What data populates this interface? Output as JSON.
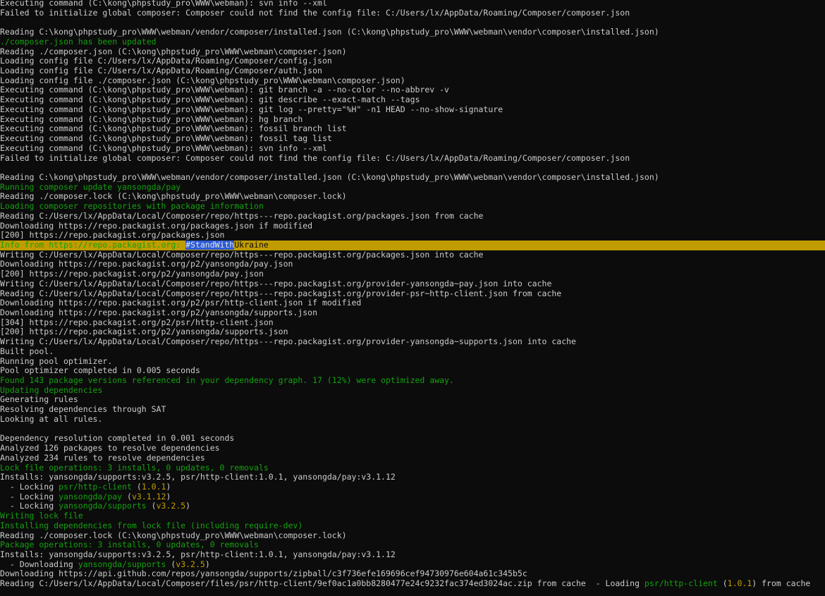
{
  "terminal": {
    "colors": {
      "background": "#0c0c0c",
      "default": "#cccccc",
      "green": "#13a10e",
      "yellow": "#c19c00",
      "selection": "#2c5bd6"
    },
    "lines": [
      {
        "segments": [
          {
            "t": "Executing command (C:\\kong\\phpstudy_pro\\WWW\\webman): svn info --xml",
            "c": "default"
          }
        ]
      },
      {
        "segments": [
          {
            "t": "Failed to initialize global composer: Composer could not find the config file: C:/Users/lx/AppData/Roaming/Composer/composer.json",
            "c": "default"
          }
        ]
      },
      {
        "segments": [
          {
            "t": "",
            "c": "default"
          }
        ]
      },
      {
        "segments": [
          {
            "t": "Reading C:\\kong\\phpstudy_pro\\WWW\\webman/vendor/composer/installed.json (C:\\kong\\phpstudy_pro\\WWW\\webman\\vendor\\composer\\installed.json)",
            "c": "default"
          }
        ]
      },
      {
        "segments": [
          {
            "t": "./composer.json has been updated",
            "c": "green"
          }
        ]
      },
      {
        "segments": [
          {
            "t": "Reading ./composer.json (C:\\kong\\phpstudy_pro\\WWW\\webman\\composer.json)",
            "c": "default"
          }
        ]
      },
      {
        "segments": [
          {
            "t": "Loading config file C:/Users/lx/AppData/Roaming/Composer/config.json",
            "c": "default"
          }
        ]
      },
      {
        "segments": [
          {
            "t": "Loading config file C:/Users/lx/AppData/Roaming/Composer/auth.json",
            "c": "default"
          }
        ]
      },
      {
        "segments": [
          {
            "t": "Loading config file ./composer.json (C:\\kong\\phpstudy_pro\\WWW\\webman\\composer.json)",
            "c": "default"
          }
        ]
      },
      {
        "segments": [
          {
            "t": "Executing command (C:\\kong\\phpstudy_pro\\WWW\\webman): git branch -a --no-color --no-abbrev -v",
            "c": "default"
          }
        ]
      },
      {
        "segments": [
          {
            "t": "Executing command (C:\\kong\\phpstudy_pro\\WWW\\webman): git describe --exact-match --tags",
            "c": "default"
          }
        ]
      },
      {
        "segments": [
          {
            "t": "Executing command (C:\\kong\\phpstudy_pro\\WWW\\webman): git log --pretty=\"%H\" -n1 HEAD --no-show-signature",
            "c": "default"
          }
        ]
      },
      {
        "segments": [
          {
            "t": "Executing command (C:\\kong\\phpstudy_pro\\WWW\\webman): hg branch",
            "c": "default"
          }
        ]
      },
      {
        "segments": [
          {
            "t": "Executing command (C:\\kong\\phpstudy_pro\\WWW\\webman): fossil branch list",
            "c": "default"
          }
        ]
      },
      {
        "segments": [
          {
            "t": "Executing command (C:\\kong\\phpstudy_pro\\WWW\\webman): fossil tag list",
            "c": "default"
          }
        ]
      },
      {
        "segments": [
          {
            "t": "Executing command (C:\\kong\\phpstudy_pro\\WWW\\webman): svn info --xml",
            "c": "default"
          }
        ]
      },
      {
        "segments": [
          {
            "t": "Failed to initialize global composer: Composer could not find the config file: C:/Users/lx/AppData/Roaming/Composer/composer.json",
            "c": "default"
          }
        ]
      },
      {
        "segments": [
          {
            "t": "",
            "c": "default"
          }
        ]
      },
      {
        "segments": [
          {
            "t": "Reading C:\\kong\\phpstudy_pro\\WWW\\webman/vendor/composer/installed.json (C:\\kong\\phpstudy_pro\\WWW\\webman\\vendor\\composer\\installed.json)",
            "c": "default"
          }
        ]
      },
      {
        "segments": [
          {
            "t": "Running composer update yansongda/pay",
            "c": "green"
          }
        ]
      },
      {
        "segments": [
          {
            "t": "Reading ./composer.lock (C:\\kong\\phpstudy_pro\\WWW\\webman\\composer.lock)",
            "c": "default"
          }
        ]
      },
      {
        "segments": [
          {
            "t": "Loading composer repositories with package information",
            "c": "green"
          }
        ]
      },
      {
        "segments": [
          {
            "t": "Reading C:/Users/lx/AppData/Local/Composer/repo/https---repo.packagist.org/packages.json from cache",
            "c": "default"
          }
        ]
      },
      {
        "segments": [
          {
            "t": "Downloading https://repo.packagist.org/packages.json if modified",
            "c": "default"
          }
        ]
      },
      {
        "segments": [
          {
            "t": "[200] https://repo.packagist.org/packages.json",
            "c": "default"
          }
        ]
      },
      {
        "band": true,
        "segments": [
          {
            "t": "Info from https://repo.packagist.org: ",
            "c": "green"
          },
          {
            "t": "#StandWith",
            "c": "sel"
          },
          {
            "t": "Ukraine",
            "c": "default"
          }
        ]
      },
      {
        "segments": [
          {
            "t": "Writing C:/Users/lx/AppData/Local/Composer/repo/https---repo.packagist.org/packages.json into cache",
            "c": "default"
          }
        ]
      },
      {
        "segments": [
          {
            "t": "Downloading https://repo.packagist.org/p2/yansongda/pay.json",
            "c": "default"
          }
        ]
      },
      {
        "segments": [
          {
            "t": "[200] https://repo.packagist.org/p2/yansongda/pay.json",
            "c": "default"
          }
        ]
      },
      {
        "segments": [
          {
            "t": "Writing C:/Users/lx/AppData/Local/Composer/repo/https---repo.packagist.org/provider-yansongda~pay.json into cache",
            "c": "default"
          }
        ]
      },
      {
        "segments": [
          {
            "t": "Reading C:/Users/lx/AppData/Local/Composer/repo/https---repo.packagist.org/provider-psr~http-client.json from cache",
            "c": "default"
          }
        ]
      },
      {
        "segments": [
          {
            "t": "Downloading https://repo.packagist.org/p2/psr/http-client.json if modified",
            "c": "default"
          }
        ]
      },
      {
        "segments": [
          {
            "t": "Downloading https://repo.packagist.org/p2/yansongda/supports.json",
            "c": "default"
          }
        ]
      },
      {
        "segments": [
          {
            "t": "[304] https://repo.packagist.org/p2/psr/http-client.json",
            "c": "default"
          }
        ]
      },
      {
        "segments": [
          {
            "t": "[200] https://repo.packagist.org/p2/yansongda/supports.json",
            "c": "default"
          }
        ]
      },
      {
        "segments": [
          {
            "t": "Writing C:/Users/lx/AppData/Local/Composer/repo/https---repo.packagist.org/provider-yansongda~supports.json into cache",
            "c": "default"
          }
        ]
      },
      {
        "segments": [
          {
            "t": "Built pool.",
            "c": "default"
          }
        ]
      },
      {
        "segments": [
          {
            "t": "Running pool optimizer.",
            "c": "default"
          }
        ]
      },
      {
        "segments": [
          {
            "t": "Pool optimizer completed in 0.005 seconds",
            "c": "default"
          }
        ]
      },
      {
        "segments": [
          {
            "t": "Found 143 package versions referenced in your dependency graph. 17 (12%) were optimized away.",
            "c": "green"
          }
        ]
      },
      {
        "segments": [
          {
            "t": "Updating dependencies",
            "c": "green"
          }
        ]
      },
      {
        "segments": [
          {
            "t": "Generating rules",
            "c": "default"
          }
        ]
      },
      {
        "segments": [
          {
            "t": "Resolving dependencies through SAT",
            "c": "default"
          }
        ]
      },
      {
        "segments": [
          {
            "t": "Looking at all rules.",
            "c": "default"
          }
        ]
      },
      {
        "segments": [
          {
            "t": "",
            "c": "default"
          }
        ]
      },
      {
        "segments": [
          {
            "t": "Dependency resolution completed in 0.001 seconds",
            "c": "default"
          }
        ]
      },
      {
        "segments": [
          {
            "t": "Analyzed 126 packages to resolve dependencies",
            "c": "default"
          }
        ]
      },
      {
        "segments": [
          {
            "t": "Analyzed 234 rules to resolve dependencies",
            "c": "default"
          }
        ]
      },
      {
        "segments": [
          {
            "t": "Lock file operations: 3 installs, 0 updates, 0 removals",
            "c": "green"
          }
        ]
      },
      {
        "segments": [
          {
            "t": "Installs: yansongda/supports:v3.2.5, psr/http-client:1.0.1, yansongda/pay:v3.1.12",
            "c": "default"
          }
        ]
      },
      {
        "segments": [
          {
            "t": "  - Locking ",
            "c": "default"
          },
          {
            "t": "psr/http-client",
            "c": "green"
          },
          {
            "t": " (",
            "c": "default"
          },
          {
            "t": "1.0.1",
            "c": "yellow"
          },
          {
            "t": ")",
            "c": "default"
          }
        ]
      },
      {
        "segments": [
          {
            "t": "  - Locking ",
            "c": "default"
          },
          {
            "t": "yansongda/pay",
            "c": "green"
          },
          {
            "t": " (",
            "c": "default"
          },
          {
            "t": "v3.1.12",
            "c": "yellow"
          },
          {
            "t": ")",
            "c": "default"
          }
        ]
      },
      {
        "segments": [
          {
            "t": "  - Locking ",
            "c": "default"
          },
          {
            "t": "yansongda/supports",
            "c": "green"
          },
          {
            "t": " (",
            "c": "default"
          },
          {
            "t": "v3.2.5",
            "c": "yellow"
          },
          {
            "t": ")",
            "c": "default"
          }
        ]
      },
      {
        "segments": [
          {
            "t": "Writing lock file",
            "c": "green"
          }
        ]
      },
      {
        "segments": [
          {
            "t": "Installing dependencies from lock file (including require-dev)",
            "c": "green"
          }
        ]
      },
      {
        "segments": [
          {
            "t": "Reading ./composer.lock (C:\\kong\\phpstudy_pro\\WWW\\webman\\composer.lock)",
            "c": "default"
          }
        ]
      },
      {
        "segments": [
          {
            "t": "Package operations: 3 installs, 0 updates, 0 removals",
            "c": "green"
          }
        ]
      },
      {
        "segments": [
          {
            "t": "Installs: yansongda/supports:v3.2.5, psr/http-client:1.0.1, yansongda/pay:v3.1.12",
            "c": "default"
          }
        ]
      },
      {
        "segments": [
          {
            "t": "  - Downloading ",
            "c": "default"
          },
          {
            "t": "yansongda/supports",
            "c": "green"
          },
          {
            "t": " (",
            "c": "default"
          },
          {
            "t": "v3.2.5",
            "c": "yellow"
          },
          {
            "t": ")",
            "c": "default"
          }
        ]
      },
      {
        "segments": [
          {
            "t": "Downloading https://api.github.com/repos/yansongda/supports/zipball/c3f736efe169696cef94730976e604a61c345b5c",
            "c": "default"
          }
        ]
      },
      {
        "segments": [
          {
            "t": "Reading C:/Users/lx/AppData/Local/Composer/files/psr/http-client/9ef0ac1a0bb8280477e24c9232fac374ed3024ac.zip from cache  - Loading ",
            "c": "default"
          },
          {
            "t": "psr/http-client",
            "c": "green"
          },
          {
            "t": " (",
            "c": "default"
          },
          {
            "t": "1.0.1",
            "c": "yellow"
          },
          {
            "t": ") from cache",
            "c": "default"
          }
        ]
      }
    ]
  }
}
